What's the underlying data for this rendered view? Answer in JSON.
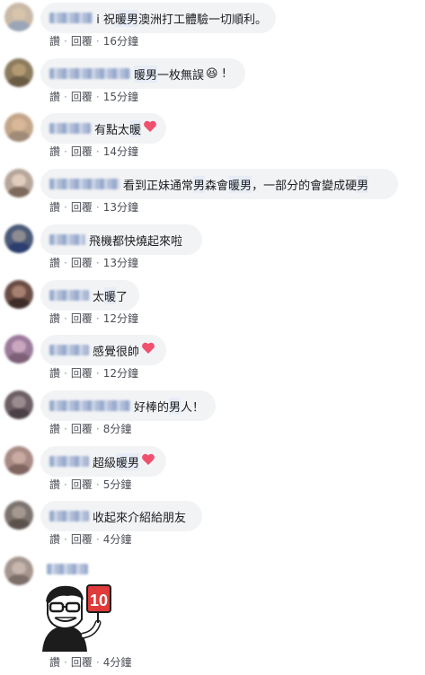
{
  "comments": [
    {
      "text_parts": [
        {
          "t": "i 祝"
        },
        {
          "t": "暖男",
          "hl": true
        },
        {
          "t": "澳洲打工體驗一切順利。"
        }
      ],
      "name_w": 50,
      "bubble_w": 262,
      "emoji": "",
      "time": "16分鐘",
      "avatar": {
        "bg": "#c9b9a6",
        "face": "#d8c3ab",
        "body": "#9aa6b8"
      }
    },
    {
      "text_parts": [
        {
          "t": ""
        },
        {
          "t": "暖男",
          "hl": true
        },
        {
          "t": "一枚無誤"
        }
      ],
      "name_w": 90,
      "bubble_w": 228,
      "emoji": "😆 !",
      "time": "15分鐘",
      "avatar": {
        "bg": "#8c7b5e",
        "face": "#b39a72",
        "body": "#6a5b45"
      }
    },
    {
      "text_parts": [
        {
          "t": "有點太"
        },
        {
          "t": "暖",
          "hl": true
        }
      ],
      "name_w": 48,
      "bubble_w": 140,
      "emoji": "heart",
      "time": "14分鐘",
      "avatar": {
        "bg": "#c4a689",
        "face": "#d8b898",
        "body": "#a08a78"
      }
    },
    {
      "text_parts": [
        {
          "t": "看到正妹通常"
        },
        {
          "t": "男",
          "hl": true
        },
        {
          "t": "森會"
        },
        {
          "t": "暖男",
          "hl": true
        },
        {
          "t": "，一部分的會變成硬"
        },
        {
          "t": "男",
          "hl": true
        }
      ],
      "name_w": 78,
      "bubble_w": 398,
      "emoji": "",
      "time": "13分鐘",
      "avatar": {
        "bg": "#b7a79a",
        "face": "#e1cdbd",
        "body": "#7d6a5c"
      }
    },
    {
      "text_parts": [
        {
          "t": "飛機都快燒起來啦"
        }
      ],
      "name_w": 40,
      "bubble_w": 180,
      "emoji": "",
      "time": "13分鐘",
      "avatar": {
        "bg": "#4a5a78",
        "face": "#8d8a90",
        "body": "#2c3e6e"
      }
    },
    {
      "text_parts": [
        {
          "t": "太"
        },
        {
          "t": "暖",
          "hl": true
        },
        {
          "t": "了"
        }
      ],
      "name_w": 44,
      "bubble_w": 110,
      "emoji": "",
      "time": "12分鐘",
      "avatar": {
        "bg": "#6b4d45",
        "face": "#a78070",
        "body": "#3e2c28"
      }
    },
    {
      "text_parts": [
        {
          "t": "感覺很帥"
        }
      ],
      "name_w": 44,
      "bubble_w": 140,
      "emoji": "heart",
      "time": "12分鐘",
      "avatar": {
        "bg": "#9c7a9a",
        "face": "#caa7bf",
        "body": "#7d6077"
      }
    },
    {
      "text_parts": [
        {
          "t": "好棒的"
        },
        {
          "t": "男",
          "hl": true
        },
        {
          "t": "人！"
        }
      ],
      "name_w": 90,
      "bubble_w": 195,
      "emoji": "",
      "time": "8分鐘",
      "avatar": {
        "bg": "#6b5e64",
        "face": "#9a8b8f",
        "body": "#4c4047"
      }
    },
    {
      "text_parts": [
        {
          "t": "超級"
        },
        {
          "t": "暖男",
          "hl": true
        }
      ],
      "name_w": 44,
      "bubble_w": 140,
      "emoji": "heart",
      "time": "5分鐘",
      "avatar": {
        "bg": "#a98a84",
        "face": "#c8aaa1",
        "body": "#7f6460"
      }
    },
    {
      "text_parts": [
        {
          "t": "收起來介紹給朋友"
        }
      ],
      "name_w": 44,
      "bubble_w": 180,
      "emoji": "",
      "time": "4分鐘",
      "avatar": {
        "bg": "#7d736e",
        "face": "#a59890",
        "body": "#5b524d"
      }
    }
  ],
  "last_comment": {
    "time": "4分鐘",
    "name_w": 46,
    "avatar": {
      "bg": "#a5958f",
      "face": "#c7b6ad",
      "body": "#7c6e69"
    },
    "sticker_label": "10"
  },
  "labels": {
    "like": "讚",
    "reply": "回覆",
    "dot": "·"
  },
  "colors": {
    "link": "#4b4f56",
    "bubble": "#f2f3f5",
    "heart": "#f0506e",
    "sticker_red": "#e03a3a"
  }
}
